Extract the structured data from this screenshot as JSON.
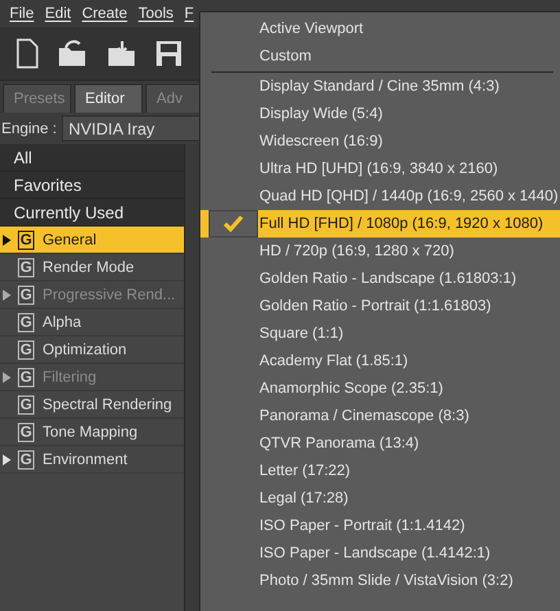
{
  "menu_bar": [
    "File",
    "Edit",
    "Create",
    "Tools",
    "F"
  ],
  "tabs": [
    {
      "label": "Presets",
      "selected": false
    },
    {
      "label": "Editor",
      "selected": true
    },
    {
      "label": "Adv",
      "selected": false
    }
  ],
  "engine": {
    "label": "Engine :",
    "value": "NVIDIA Iray"
  },
  "filters": [
    {
      "label": "All"
    },
    {
      "label": "Favorites"
    },
    {
      "label": "Currently Used"
    }
  ],
  "groups": [
    {
      "badge": "G",
      "label": "General",
      "expandable": true,
      "disabled": false,
      "selected": true
    },
    {
      "badge": "G",
      "label": "Render Mode",
      "expandable": false,
      "disabled": false,
      "selected": false
    },
    {
      "badge": "G",
      "label": "Progressive Rend...",
      "expandable": true,
      "disabled": true,
      "selected": false
    },
    {
      "badge": "G",
      "label": "Alpha",
      "expandable": false,
      "disabled": false,
      "selected": false
    },
    {
      "badge": "G",
      "label": "Optimization",
      "expandable": false,
      "disabled": false,
      "selected": false
    },
    {
      "badge": "G",
      "label": "Filtering",
      "expandable": true,
      "disabled": true,
      "selected": false
    },
    {
      "badge": "G",
      "label": "Spectral Rendering",
      "expandable": false,
      "disabled": false,
      "selected": false
    },
    {
      "badge": "G",
      "label": "Tone Mapping",
      "expandable": false,
      "disabled": false,
      "selected": false
    },
    {
      "badge": "G",
      "label": "Environment",
      "expandable": true,
      "disabled": false,
      "selected": false
    }
  ],
  "popup_menu": [
    {
      "kind": "item",
      "label": "Active Viewport",
      "selected": false
    },
    {
      "kind": "item",
      "label": "Custom",
      "selected": false
    },
    {
      "kind": "separator"
    },
    {
      "kind": "item",
      "label": "Display Standard / Cine 35mm (4:3)",
      "selected": false
    },
    {
      "kind": "item",
      "label": "Display Wide (5:4)",
      "selected": false
    },
    {
      "kind": "item",
      "label": "Widescreen (16:9)",
      "selected": false
    },
    {
      "kind": "item",
      "label": "Ultra HD [UHD] (16:9, 3840 x 2160)",
      "selected": false
    },
    {
      "kind": "item",
      "label": "Quad HD [QHD] / 1440p (16:9, 2560 x 1440)",
      "selected": false
    },
    {
      "kind": "item",
      "label": "Full HD [FHD] / 1080p (16:9, 1920 x 1080)",
      "selected": true
    },
    {
      "kind": "item",
      "label": "HD / 720p (16:9, 1280 x 720)",
      "selected": false
    },
    {
      "kind": "item",
      "label": "Golden Ratio - Landscape (1.61803:1)",
      "selected": false
    },
    {
      "kind": "item",
      "label": "Golden Ratio - Portrait (1:1.61803)",
      "selected": false
    },
    {
      "kind": "item",
      "label": "Square (1:1)",
      "selected": false
    },
    {
      "kind": "item",
      "label": "Academy Flat (1.85:1)",
      "selected": false
    },
    {
      "kind": "item",
      "label": "Anamorphic Scope (2.35:1)",
      "selected": false
    },
    {
      "kind": "item",
      "label": "Panorama / Cinemascope (8:3)",
      "selected": false
    },
    {
      "kind": "item",
      "label": "QTVR Panorama (13:4)",
      "selected": false
    },
    {
      "kind": "item",
      "label": "Letter (17:22)",
      "selected": false
    },
    {
      "kind": "item",
      "label": "Legal (17:28)",
      "selected": false
    },
    {
      "kind": "item",
      "label": "ISO Paper - Portrait (1:1.4142)",
      "selected": false
    },
    {
      "kind": "item",
      "label": "ISO Paper - Landscape (1.4142:1)",
      "selected": false
    },
    {
      "kind": "item",
      "label": "Photo / 35mm Slide / VistaVision (3:2)",
      "selected": false
    }
  ]
}
